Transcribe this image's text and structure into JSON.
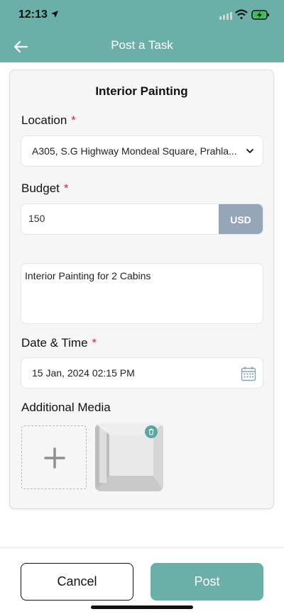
{
  "status_bar": {
    "time": "12:13"
  },
  "header": {
    "title": "Post a Task"
  },
  "form": {
    "task_title": "Interior Painting",
    "location": {
      "label": "Location",
      "required_mark": "*",
      "value": "A305, S.G Highway Mondeal Square, Prahla..."
    },
    "budget": {
      "label": "Budget",
      "required_mark": "*",
      "value": "150",
      "currency": "USD"
    },
    "description": {
      "value": "Interior Painting for 2 Cabins"
    },
    "date_time": {
      "label": "Date & Time",
      "required_mark": "*",
      "value": "15 Jan, 2024 02:15 PM"
    },
    "media": {
      "label": "Additional Media"
    }
  },
  "footer": {
    "cancel_label": "Cancel",
    "post_label": "Post"
  },
  "colors": {
    "accent": "#6bb0a8",
    "required": "#d62a2a",
    "currency_bg": "#94a6b7"
  },
  "icons": [
    "location-arrow-icon",
    "signal-icon",
    "wifi-icon",
    "battery-charging-icon",
    "back-arrow-icon",
    "chevron-down-icon",
    "calendar-icon",
    "plus-icon",
    "trash-icon"
  ]
}
